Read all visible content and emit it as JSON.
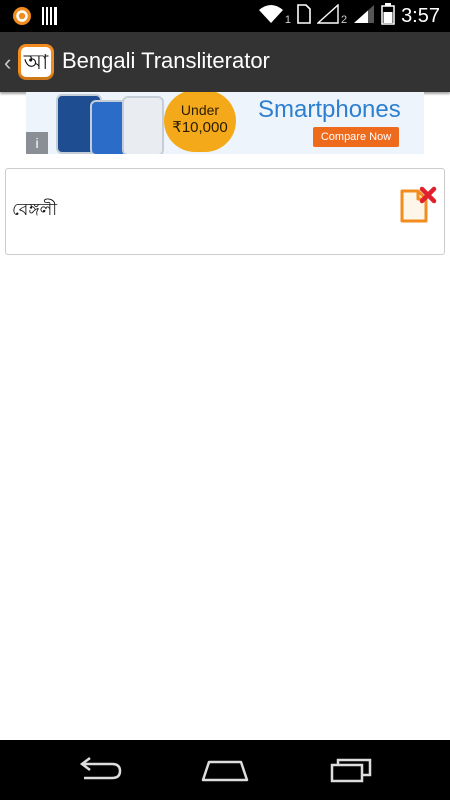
{
  "status_bar": {
    "time": "3:57",
    "sim1_label": "1",
    "sim2_label": "2",
    "icons": [
      "notification-circle-icon",
      "barcode-icon",
      "wifi-icon",
      "sim-card-icon",
      "signal-icon",
      "battery-icon"
    ]
  },
  "action_bar": {
    "app_icon_glyph": "আ",
    "title": "Bengali Transliterator"
  },
  "ad": {
    "badge_line1": "Under",
    "badge_line2": "₹10,000",
    "headline": "Smartphones",
    "cta": "Compare Now",
    "info": "i"
  },
  "input": {
    "value": "বেঙ্গলী"
  },
  "colors": {
    "action_bar_bg": "#333333",
    "accent_orange": "#f28c1e",
    "clear_red": "#e0202a"
  }
}
